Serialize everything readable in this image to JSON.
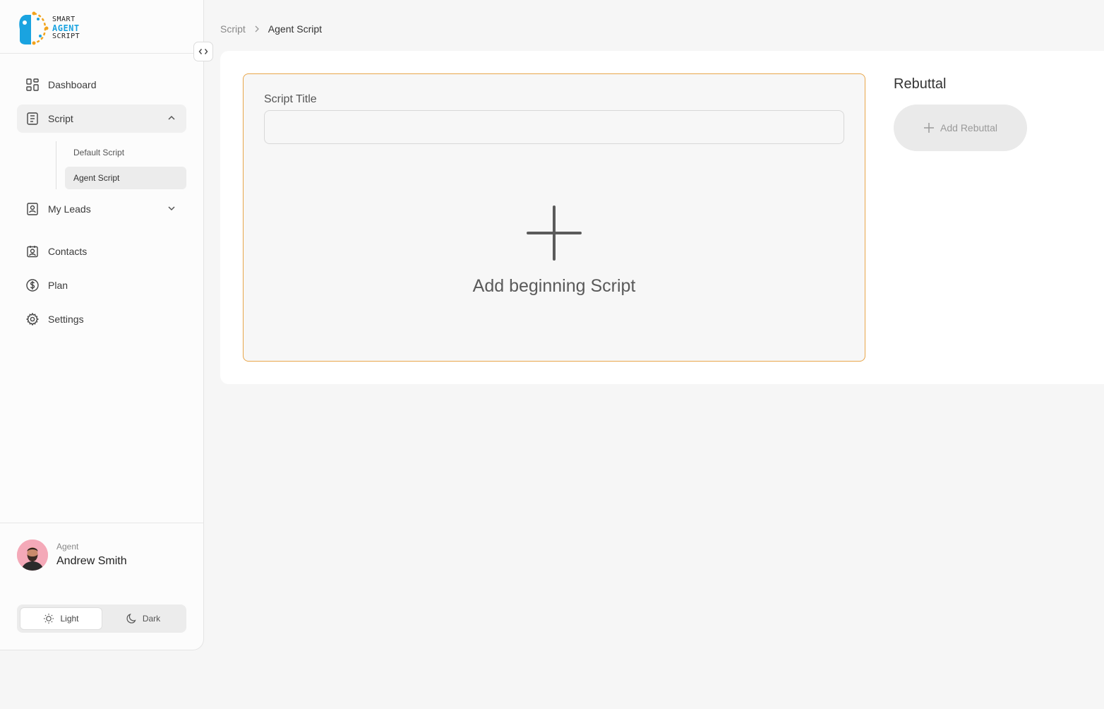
{
  "app": {
    "logo_lines": [
      "SMART",
      "AGENT",
      "SCRIPT"
    ]
  },
  "sidebar": {
    "items": [
      {
        "label": "Dashboard",
        "icon": "dashboard-grid-icon"
      },
      {
        "label": "Script",
        "icon": "script-document-icon",
        "expanded": true,
        "children": [
          {
            "label": "Default Script"
          },
          {
            "label": "Agent Script",
            "active": true
          }
        ]
      },
      {
        "label": "My Leads",
        "icon": "leads-icon",
        "expanded": false
      },
      {
        "label": "Contacts",
        "icon": "contacts-icon"
      },
      {
        "label": "Plan",
        "icon": "dollar-circle-icon"
      },
      {
        "label": "Settings",
        "icon": "gear-icon"
      }
    ]
  },
  "user": {
    "role": "Agent",
    "name": "Andrew Smith"
  },
  "theme": {
    "light_label": "Light",
    "dark_label": "Dark",
    "selected": "Light"
  },
  "breadcrumb": {
    "parent": "Script",
    "current": "Agent Script"
  },
  "script_editor": {
    "title_label": "Script Title",
    "title_value": "",
    "add_beginning_label": "Add beginning Script"
  },
  "rebuttal": {
    "title": "Rebuttal",
    "add_label": "Add Rebuttal"
  },
  "colors": {
    "accent_border": "#e8a64a",
    "logo_blue": "#1aa3e0"
  }
}
